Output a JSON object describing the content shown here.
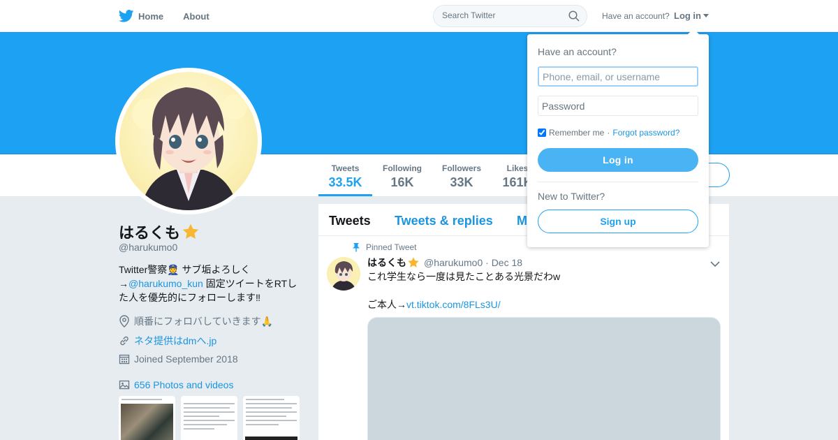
{
  "nav": {
    "home_label": "Home",
    "about_label": "About",
    "search_placeholder": "Search Twitter",
    "have_account": "Have an account?",
    "login_label": "Log in"
  },
  "profile": {
    "name": "はるくも",
    "handle": "@harukumo0",
    "bio_line1": "Twitter警察👮 サブ垢よろしく",
    "bio_arrow": "→",
    "bio_mention": "@harukumo_kun",
    "bio_rest1": " 固定ツイートをRTし",
    "bio_line3": "た人を優先的にフォローします‼",
    "location": "順番にフォロバしていきます🙏",
    "website": "ネタ提供はdmへ.jp",
    "joined": "Joined September 2018",
    "photos_link": "656 Photos and videos"
  },
  "stats": [
    {
      "label": "Tweets",
      "value": "33.5K"
    },
    {
      "label": "Following",
      "value": "16K"
    },
    {
      "label": "Followers",
      "value": "33K"
    },
    {
      "label": "Likes",
      "value": "161K"
    }
  ],
  "timeline": {
    "tabs": [
      "Tweets",
      "Tweets & replies",
      "M"
    ],
    "pinned_label": "Pinned Tweet",
    "tweet": {
      "name": "はるくも",
      "handle_date": "@harukumo0 · Dec 18",
      "text1": "これ学生なら一度は見たことある光景だわw",
      "text2_prefix": "ご本人→",
      "text2_link": "vt.tiktok.com/8FLs3U/"
    }
  },
  "login_dropdown": {
    "title": "Have an account?",
    "username_placeholder": "Phone, email, or username",
    "password_placeholder": "Password",
    "remember_label": "Remember me",
    "separator": "·",
    "forgot_label": "Forgot password?",
    "login_button": "Log in",
    "new_label": "New to Twitter?",
    "signup_button": "Sign up"
  },
  "colors": {
    "brand": "#1da1f2",
    "link": "#1b95e0",
    "background": "#e6ecf0"
  }
}
